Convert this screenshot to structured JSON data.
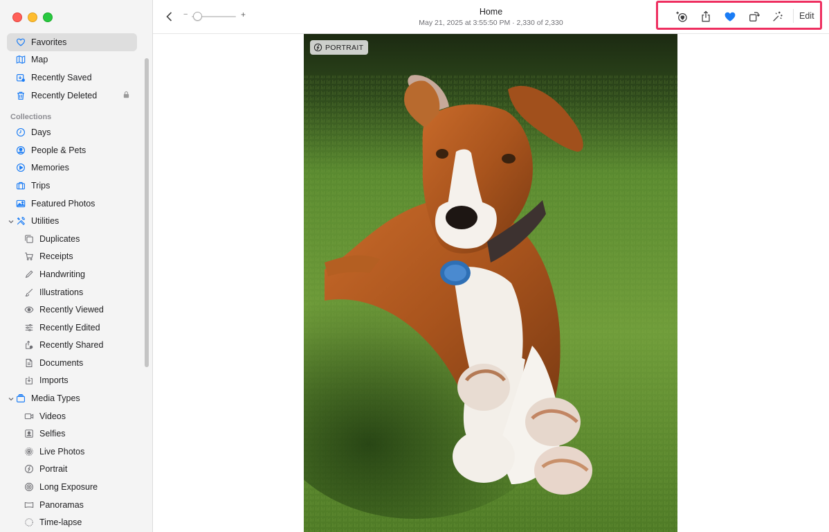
{
  "window": {
    "toolbar": {
      "title": "Home",
      "subtitle": "May 21, 2025 at 3:55:50 PM  ·  2,330 of 2,330",
      "zoom_minus": "−",
      "zoom_plus": "+",
      "edit_label": "Edit"
    }
  },
  "sidebar": {
    "pinned": [
      {
        "label": "Favorites",
        "icon": "heart-icon"
      },
      {
        "label": "Map",
        "icon": "map-icon"
      },
      {
        "label": "Recently Saved",
        "icon": "recently-saved-icon"
      },
      {
        "label": "Recently Deleted",
        "icon": "trash-icon"
      }
    ],
    "collections_header": "Collections",
    "collections": [
      {
        "label": "Days",
        "icon": "clock-icon"
      },
      {
        "label": "People & Pets",
        "icon": "person-circle-icon"
      },
      {
        "label": "Memories",
        "icon": "memories-icon"
      },
      {
        "label": "Trips",
        "icon": "suitcase-icon"
      },
      {
        "label": "Featured Photos",
        "icon": "photo-icon"
      }
    ],
    "utilities_label": "Utilities",
    "utilities": [
      {
        "label": "Duplicates",
        "icon": "duplicates-icon"
      },
      {
        "label": "Receipts",
        "icon": "cart-icon"
      },
      {
        "label": "Handwriting",
        "icon": "pencil-icon"
      },
      {
        "label": "Illustrations",
        "icon": "brush-icon"
      },
      {
        "label": "Recently Viewed",
        "icon": "eye-icon"
      },
      {
        "label": "Recently Edited",
        "icon": "sliders-icon"
      },
      {
        "label": "Recently Shared",
        "icon": "shared-icon"
      },
      {
        "label": "Documents",
        "icon": "document-icon"
      },
      {
        "label": "Imports",
        "icon": "import-icon"
      }
    ],
    "media_types_label": "Media Types",
    "media_types": [
      {
        "label": "Videos",
        "icon": "video-icon"
      },
      {
        "label": "Selfies",
        "icon": "selfie-icon"
      },
      {
        "label": "Live Photos",
        "icon": "live-photo-icon"
      },
      {
        "label": "Portrait",
        "icon": "portrait-icon"
      },
      {
        "label": "Long Exposure",
        "icon": "long-exposure-icon"
      },
      {
        "label": "Panoramas",
        "icon": "panorama-icon"
      },
      {
        "label": "Time-lapse",
        "icon": "timelapse-icon"
      }
    ]
  },
  "photo": {
    "badge": "PORTRAIT"
  },
  "colors": {
    "accent": "#1a7cf5",
    "highlight_border": "#ee2e5f"
  }
}
